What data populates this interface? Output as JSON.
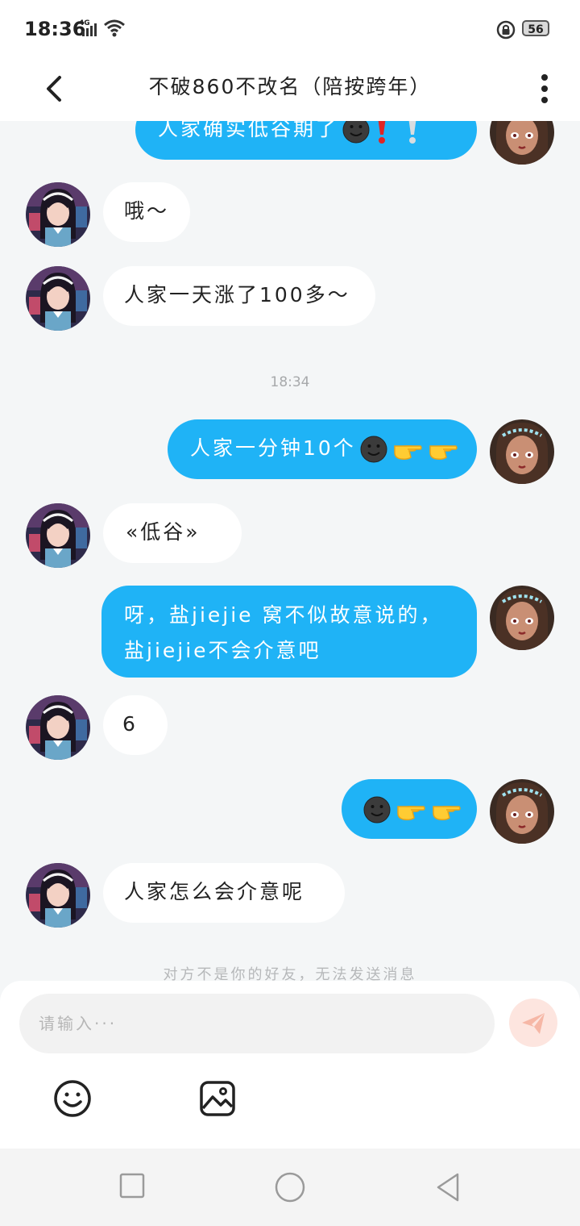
{
  "status_bar": {
    "time": "18:36",
    "network": "4G",
    "battery": "56"
  },
  "header": {
    "title": "不破860不改名（陪按跨年）"
  },
  "colors": {
    "outgoing_bubble": "#1fb3f6",
    "incoming_bubble": "#ffffff",
    "background": "#f4f6f7"
  },
  "messages": [
    {
      "side": "out",
      "text": "人家确实低谷期了",
      "emoji": [
        "dark-face",
        "red-exclamation",
        "grey-exclamation"
      ]
    },
    {
      "side": "in",
      "text": "哦～"
    },
    {
      "side": "in",
      "text": "人家一天涨了100多～"
    },
    {
      "type": "timestamp",
      "text": "18:34"
    },
    {
      "side": "out",
      "text": "人家一分钟10个",
      "emoji": [
        "dark-face",
        "pointing-hand",
        "pointing-hand"
      ]
    },
    {
      "side": "in",
      "text": "«低谷»"
    },
    {
      "side": "out",
      "text": "呀，盐jiejie 窝不似故意说的，盐jiejie不会介意吧"
    },
    {
      "side": "in",
      "text": "6"
    },
    {
      "side": "out",
      "text": "",
      "emoji": [
        "dark-face",
        "pointing-hand",
        "pointing-hand"
      ]
    },
    {
      "side": "in",
      "text": "人家怎么会介意呢"
    }
  ],
  "notice": "对方不是你的好友，无法发送消息",
  "composer": {
    "placeholder": "请输入···"
  }
}
